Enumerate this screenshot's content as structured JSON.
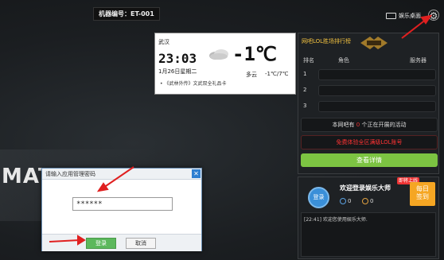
{
  "topbar": {
    "machine_id": "机器编号：ET-001",
    "desktop_label": "娱乐桌面",
    "settings_icon": "gear-icon"
  },
  "background": {
    "brand_text": "MATR"
  },
  "weather": {
    "city": "武汉",
    "time": "23:03",
    "date": "1月26日星期二",
    "temperature": "-1℃",
    "condition": "多云",
    "range": "-1℃/7℃",
    "news": "《武林外传》文武双全礼品卡",
    "icon": "cloud-icon"
  },
  "rank": {
    "title": "网吧LOL胜场排行榜",
    "col_rank": "排名",
    "col_role": "角色",
    "col_server": "服务器",
    "rows": [
      "1",
      "2",
      "3"
    ],
    "activity_prefix": "本网吧有",
    "activity_count": "0",
    "activity_suffix": "个正在开展的活动",
    "free_text": "免费体验全区满级LOL账号",
    "detail_button": "查看详情"
  },
  "chat": {
    "avatar_label": "登录",
    "title": "欢迎登录娱乐大师",
    "new_badge": "即将上线",
    "stat_diamond": "0",
    "stat_coin": "0",
    "checkin": "每日\n签到",
    "log": "[22:41] 欢迎您使用娱乐大师."
  },
  "dialog": {
    "title": "请输入应用管理密码",
    "password_value": "******",
    "login_button": "登录",
    "cancel_button": "取消"
  },
  "colors": {
    "accent_green": "#7cc442",
    "alert_red": "#ee3333",
    "arrow_red": "#e02020"
  }
}
